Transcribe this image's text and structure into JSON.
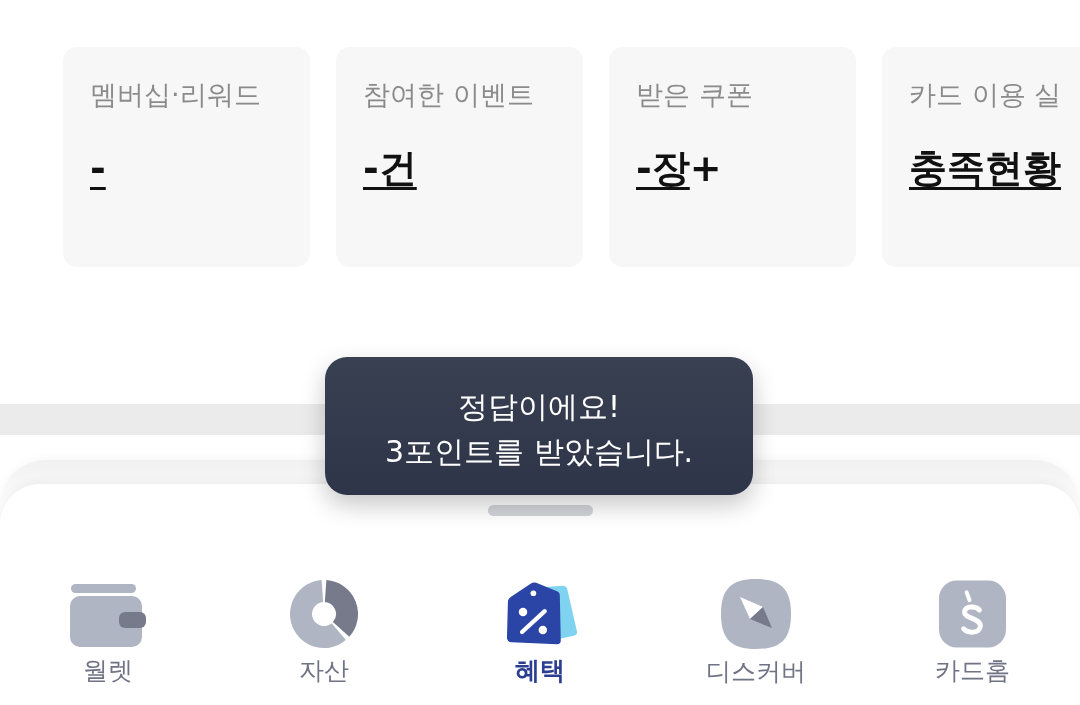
{
  "summary_cards": [
    {
      "label": "멤버십·리워드",
      "value": "-"
    },
    {
      "label": "참여한 이벤트",
      "value": "-건"
    },
    {
      "label": "받은 쿠폰",
      "value": "-장",
      "suffix": "+"
    },
    {
      "label": "카드 이용 실",
      "value": "충족현황"
    }
  ],
  "toast": {
    "lines": [
      "정답이에요!",
      "3포인트를 받았습니다."
    ]
  },
  "tab_bar": [
    {
      "label": "월렛",
      "selected": false
    },
    {
      "label": "자산",
      "selected": false
    },
    {
      "label": "혜택",
      "selected": true
    },
    {
      "label": "디스커버",
      "selected": false
    },
    {
      "label": "카드홈",
      "selected": false
    }
  ]
}
